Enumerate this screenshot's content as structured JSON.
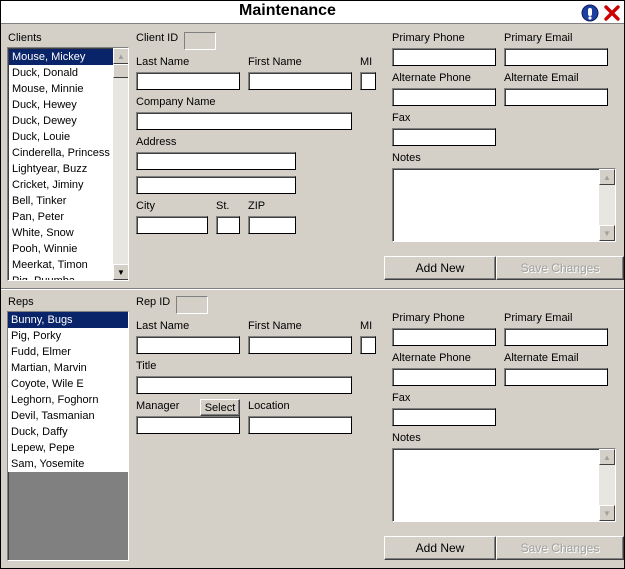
{
  "window": {
    "title": "Maintenance"
  },
  "icons": {
    "info": "info-icon",
    "close": "close-icon"
  },
  "colors": {
    "selection": "#0a246a",
    "window_bg": "#d4d0c8",
    "close_red": "#cc0000",
    "info_blue": "#1f3fa0"
  },
  "clients": {
    "list_label": "Clients",
    "items": [
      "Mouse, Mickey",
      "Duck, Donald",
      "Mouse, Minnie",
      "Duck, Hewey",
      "Duck, Dewey",
      "Duck, Louie",
      "Cinderella, Princess",
      "Lightyear, Buzz",
      "Cricket, Jiminy",
      "Bell, Tinker",
      "Pan, Peter",
      "White, Snow",
      "Pooh, Winnie",
      "Meerkat, Timon",
      "Pig, Puumba"
    ],
    "selected": "Mouse, Mickey",
    "form": {
      "client_id_label": "Client ID",
      "last_name_label": "Last Name",
      "first_name_label": "First Name",
      "mi_label": "MI",
      "company_label": "Company Name",
      "address_label": "Address",
      "city_label": "City",
      "state_label": "St.",
      "zip_label": "ZIP",
      "primary_phone_label": "Primary Phone",
      "primary_email_label": "Primary Email",
      "alt_phone_label": "Alternate Phone",
      "alt_email_label": "Alternate Email",
      "fax_label": "Fax",
      "notes_label": "Notes",
      "add_new": "Add New",
      "save_changes": "Save Changes"
    }
  },
  "reps": {
    "list_label": "Reps",
    "items": [
      "Bunny, Bugs",
      "Pig, Porky",
      "Fudd, Elmer",
      "Martian, Marvin",
      "Coyote, Wile E",
      "Leghorn, Foghorn",
      "Devil, Tasmanian",
      "Duck, Daffy",
      "Lepew, Pepe",
      "Sam, Yosemite"
    ],
    "selected": "Bunny, Bugs",
    "form": {
      "rep_id_label": "Rep ID",
      "last_name_label": "Last Name",
      "first_name_label": "First Name",
      "mi_label": "MI",
      "title_label": "Title",
      "manager_label": "Manager",
      "select_button": "Select",
      "location_label": "Location",
      "primary_phone_label": "Primary Phone",
      "primary_email_label": "Primary Email",
      "alt_phone_label": "Alternate Phone",
      "alt_email_label": "Alternate Email",
      "fax_label": "Fax",
      "notes_label": "Notes",
      "add_new": "Add New",
      "save_changes": "Save Changes"
    }
  }
}
